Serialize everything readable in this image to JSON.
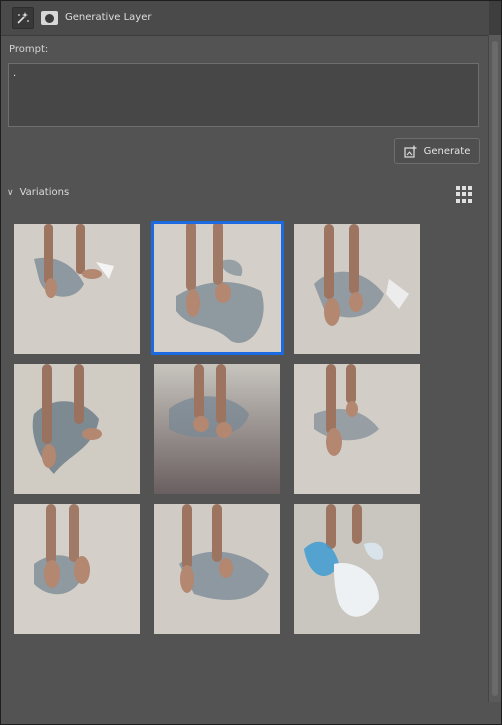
{
  "header": {
    "title": "Generative Layer",
    "icons": [
      "generative-fill-icon",
      "layer-mask-icon"
    ]
  },
  "prompt": {
    "label": "Prompt:",
    "value": "."
  },
  "generate_button": {
    "label": "Generate",
    "icon": "generate-plus-icon"
  },
  "variations": {
    "label": "Variations",
    "expanded": true,
    "selected_index": 1,
    "count": 9,
    "accent_color": "#1b6ae0"
  }
}
